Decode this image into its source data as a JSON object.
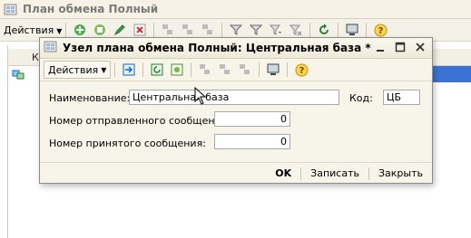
{
  "parent_window": {
    "title": "План обмена Полный",
    "actions_label": "Действия",
    "list_column_letter": "К",
    "toolbar_icons": [
      "add-icon",
      "copy-icon",
      "edit-icon",
      "delete-icon",
      "group-a-icon",
      "group-b-icon",
      "group-c-icon",
      "filter-icon",
      "filter-set-icon",
      "filter-dropdown-icon",
      "filter-clear-icon",
      "refresh-icon",
      "computer-icon",
      "help-icon"
    ]
  },
  "modal": {
    "title": "Узел плана обмена Полный: Центральная база *",
    "actions_label": "Действия",
    "form": {
      "name_label": "Наименование:",
      "name_value": "Центральная база",
      "code_label": "Код:",
      "code_value": "ЦБ",
      "sent_label": "Номер отправленного сообщения:",
      "sent_value": "0",
      "received_label": "Номер принятого сообщения:",
      "received_value": "0"
    },
    "footer": {
      "ok_label": "OK",
      "save_label": "Записать",
      "close_label": "Закрыть"
    }
  },
  "colors": {
    "selection": "#3a73d3",
    "window_bg": "#f7f4ea"
  }
}
